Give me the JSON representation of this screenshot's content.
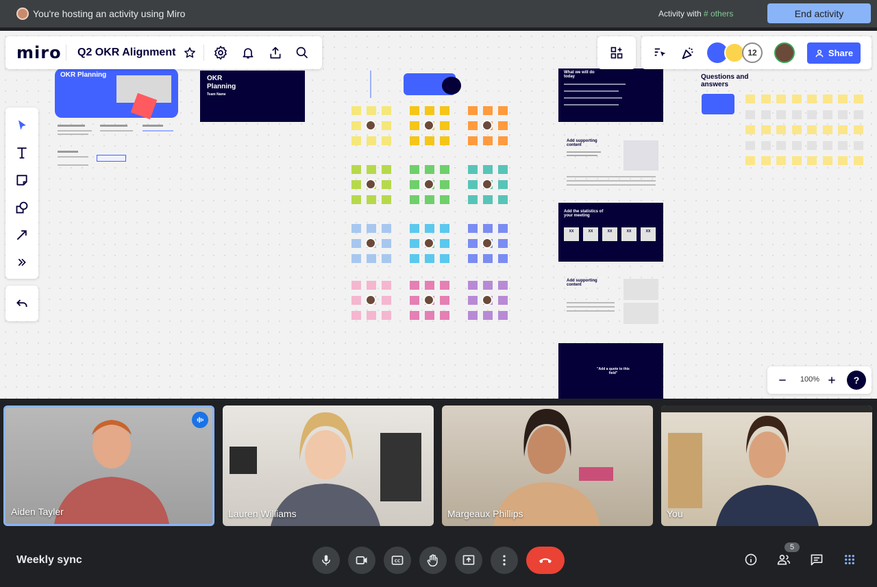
{
  "banner": {
    "host_text": "You're hosting an activity using Miro",
    "activity_prefix": "Activity with",
    "activity_others": "# others",
    "end_button": "End activity"
  },
  "miro": {
    "logo": "miro",
    "board_title": "Q2 OKR Alignment",
    "collaborator_count": "12",
    "share_label": "Share",
    "zoom": "100%",
    "help": "?",
    "tools": [
      "select",
      "text",
      "sticky-note",
      "shapes",
      "connector",
      "more"
    ],
    "frames": {
      "okr_title": "OKR Planning",
      "okr_title2": "OKR Planning",
      "team_name": "Team Name",
      "what_we_will": "What we will do today",
      "supporting": "Add supporting content",
      "stats": "Add the statistics of your meeting",
      "supporting2": "Add supporting content",
      "quote": "\"Add a quote to this field\"",
      "qa": "Questions and answers",
      "stat_value": "XX"
    },
    "colors": {
      "accent": "#4262ff",
      "navy": "#050038"
    }
  },
  "meeting": {
    "title": "Weekly sync",
    "participant_count": "5",
    "participants": [
      {
        "name": "Aiden Tayler"
      },
      {
        "name": "Lauren Williams"
      },
      {
        "name": "Margeaux Phillips"
      },
      {
        "name": "You"
      }
    ]
  }
}
